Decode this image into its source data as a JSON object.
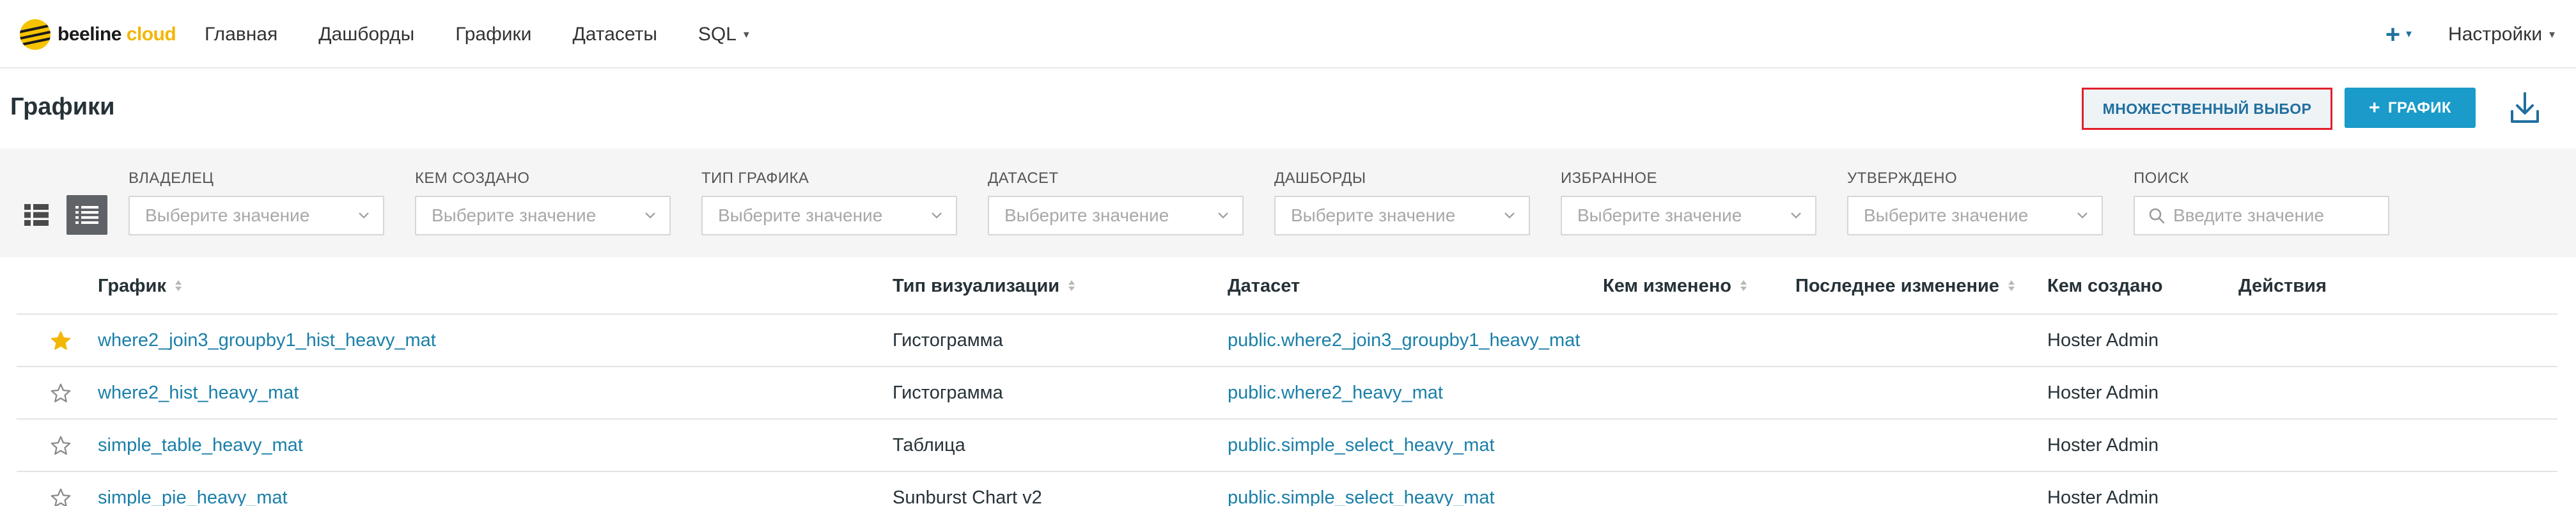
{
  "brand": {
    "name": "beeline",
    "suffix": " cloud",
    "accent": "#f2b705"
  },
  "nav": [
    {
      "label": "Главная"
    },
    {
      "label": "Дашборды"
    },
    {
      "label": "Графики"
    },
    {
      "label": "Датасеты"
    },
    {
      "label": "SQL",
      "dropdown": true
    }
  ],
  "topright": {
    "add_icon": "plus-icon",
    "settings_label": "Настройки"
  },
  "page": {
    "title": "Графики",
    "multi_select_label": "МНОЖЕСТВЕННЫЙ ВЫБОР",
    "add_chart_label": "ГРАФИК",
    "download_icon": "download-icon"
  },
  "filters": [
    {
      "label": "ВЛАДЕЛЕЦ",
      "placeholder": "Выберите значение"
    },
    {
      "label": "КЕМ СОЗДАНО",
      "placeholder": "Выберите значение"
    },
    {
      "label": "ТИП ГРАФИКА",
      "placeholder": "Выберите значение"
    },
    {
      "label": "ДАТАСЕТ",
      "placeholder": "Выберите значение"
    },
    {
      "label": "ДАШБОРДЫ",
      "placeholder": "Выберите значение"
    },
    {
      "label": "ИЗБРАННОЕ",
      "placeholder": "Выберите значение"
    },
    {
      "label": "УТВЕРЖДЕНО",
      "placeholder": "Выберите значение"
    }
  ],
  "search": {
    "label": "ПОИСК",
    "placeholder": "Введите значение"
  },
  "table": {
    "columns": [
      {
        "label": "График",
        "sortable": true
      },
      {
        "label": "Тип визуализации",
        "sortable": true
      },
      {
        "label": "Датасет",
        "sortable": false
      },
      {
        "label": "Кем изменено",
        "sortable": true
      },
      {
        "label": "Последнее изменение",
        "sortable": true
      },
      {
        "label": "Кем создано",
        "sortable": false
      },
      {
        "label": "Действия",
        "sortable": false
      }
    ],
    "rows": [
      {
        "favorite": true,
        "name": "where2_join3_groupby1_hist_heavy_mat",
        "viz": "Гистограмма",
        "dataset": "public.where2_join3_groupby1_heavy_mat",
        "modified_by": "",
        "modified": "",
        "created_by": "Hoster Admin"
      },
      {
        "favorite": false,
        "name": "where2_hist_heavy_mat",
        "viz": "Гистограмма",
        "dataset": "public.where2_heavy_mat",
        "modified_by": "",
        "modified": "",
        "created_by": "Hoster Admin"
      },
      {
        "favorite": false,
        "name": "simple_table_heavy_mat",
        "viz": "Таблица",
        "dataset": "public.simple_select_heavy_mat",
        "modified_by": "",
        "modified": "",
        "created_by": "Hoster Admin"
      },
      {
        "favorite": false,
        "name": "simple_pie_heavy_mat",
        "viz": "Sunburst Chart v2",
        "dataset": "public.simple_select_heavy_mat",
        "modified_by": "",
        "modified": "",
        "created_by": "Hoster Admin"
      }
    ]
  },
  "colors": {
    "link": "#1a7fa8",
    "primary": "#1a9bc9",
    "star_active": "#f2b705",
    "highlight_border": "#e2202a"
  }
}
